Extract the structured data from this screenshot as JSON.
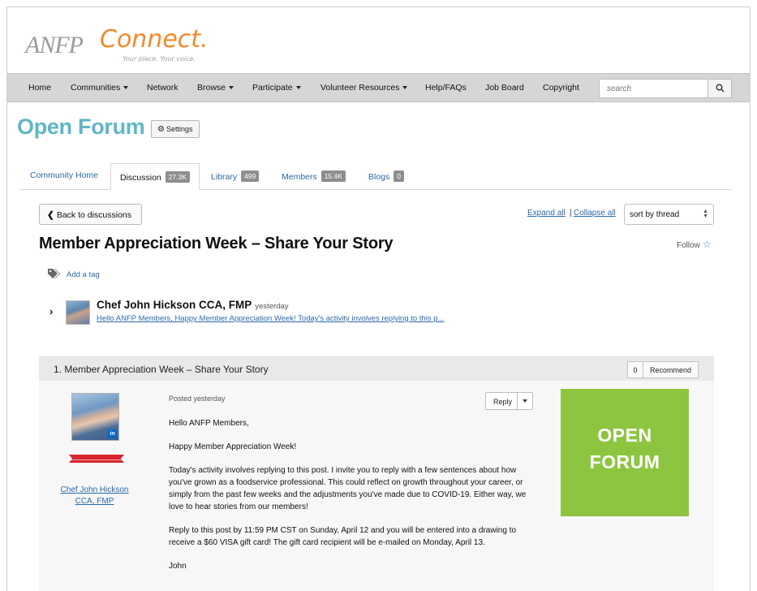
{
  "logo": {
    "anfp": "ANFP",
    "connect": "Connect.",
    "tagline": "Your place. Your voice."
  },
  "nav": {
    "items": [
      "Home",
      "Communities",
      "Network",
      "Browse",
      "Participate",
      "Volunteer Resources",
      "Help/FAQs",
      "Job Board",
      "Copyright"
    ],
    "search_placeholder": "search"
  },
  "page": {
    "title": "Open Forum",
    "settings_label": "Settings"
  },
  "tabs": [
    {
      "label": "Community Home"
    },
    {
      "label": "Discussion",
      "badge": "27.3K"
    },
    {
      "label": "Library",
      "badge": "499"
    },
    {
      "label": "Members",
      "badge": "15.4K"
    },
    {
      "label": "Blogs",
      "badge": "0"
    }
  ],
  "toolbar": {
    "back_label": "Back to discussions",
    "expand_all": "Expand all",
    "separator": "|",
    "collapse_all": "Collapse all",
    "sort_value": "sort by thread"
  },
  "thread": {
    "title": "Member Appreciation Week – Share Your Story",
    "follow_label": "Follow",
    "add_tag_label": "Add a tag",
    "author": "Chef John Hickson CCA, FMP",
    "when": "yesterday",
    "snippet": "Hello ANFP Members, Happy Member Appreciation Week! Today's activity involves replying to this p..."
  },
  "post": {
    "header": "1.  Member Appreciation Week – Share Your Story",
    "recommend_count": "0",
    "recommend_label": "Recommend",
    "posted": "Posted yesterday",
    "reply_label": "Reply",
    "author_name": "Chef John Hickson CCA, FMP",
    "paragraphs": [
      "Hello ANFP Members,",
      "Happy Member Appreciation Week!",
      "Today's activity involves replying to this post. I invite you to reply with a few sentences about how you've grown as a foodservice professional. This could reflect on growth throughout your career, or simply from the past few weeks and the adjustments you've made due to COVID-19. Either way, we love to hear stories from our members!",
      "Reply to this post by 11:59 PM CST on Sunday, April 12 and you will be entered into a drawing to receive a $60 VISA gift card! The gift card recipient will be e-mailed on Monday, April 13.",
      "John"
    ]
  },
  "promo": {
    "line1": "OPEN",
    "line2": "FORUM"
  },
  "colors": {
    "title": "#5fb7c5",
    "link": "#2a6aa8",
    "promo_green": "#8dc540",
    "logo_orange": "#f08a2c",
    "nav_bg": "#d6d6d6"
  }
}
